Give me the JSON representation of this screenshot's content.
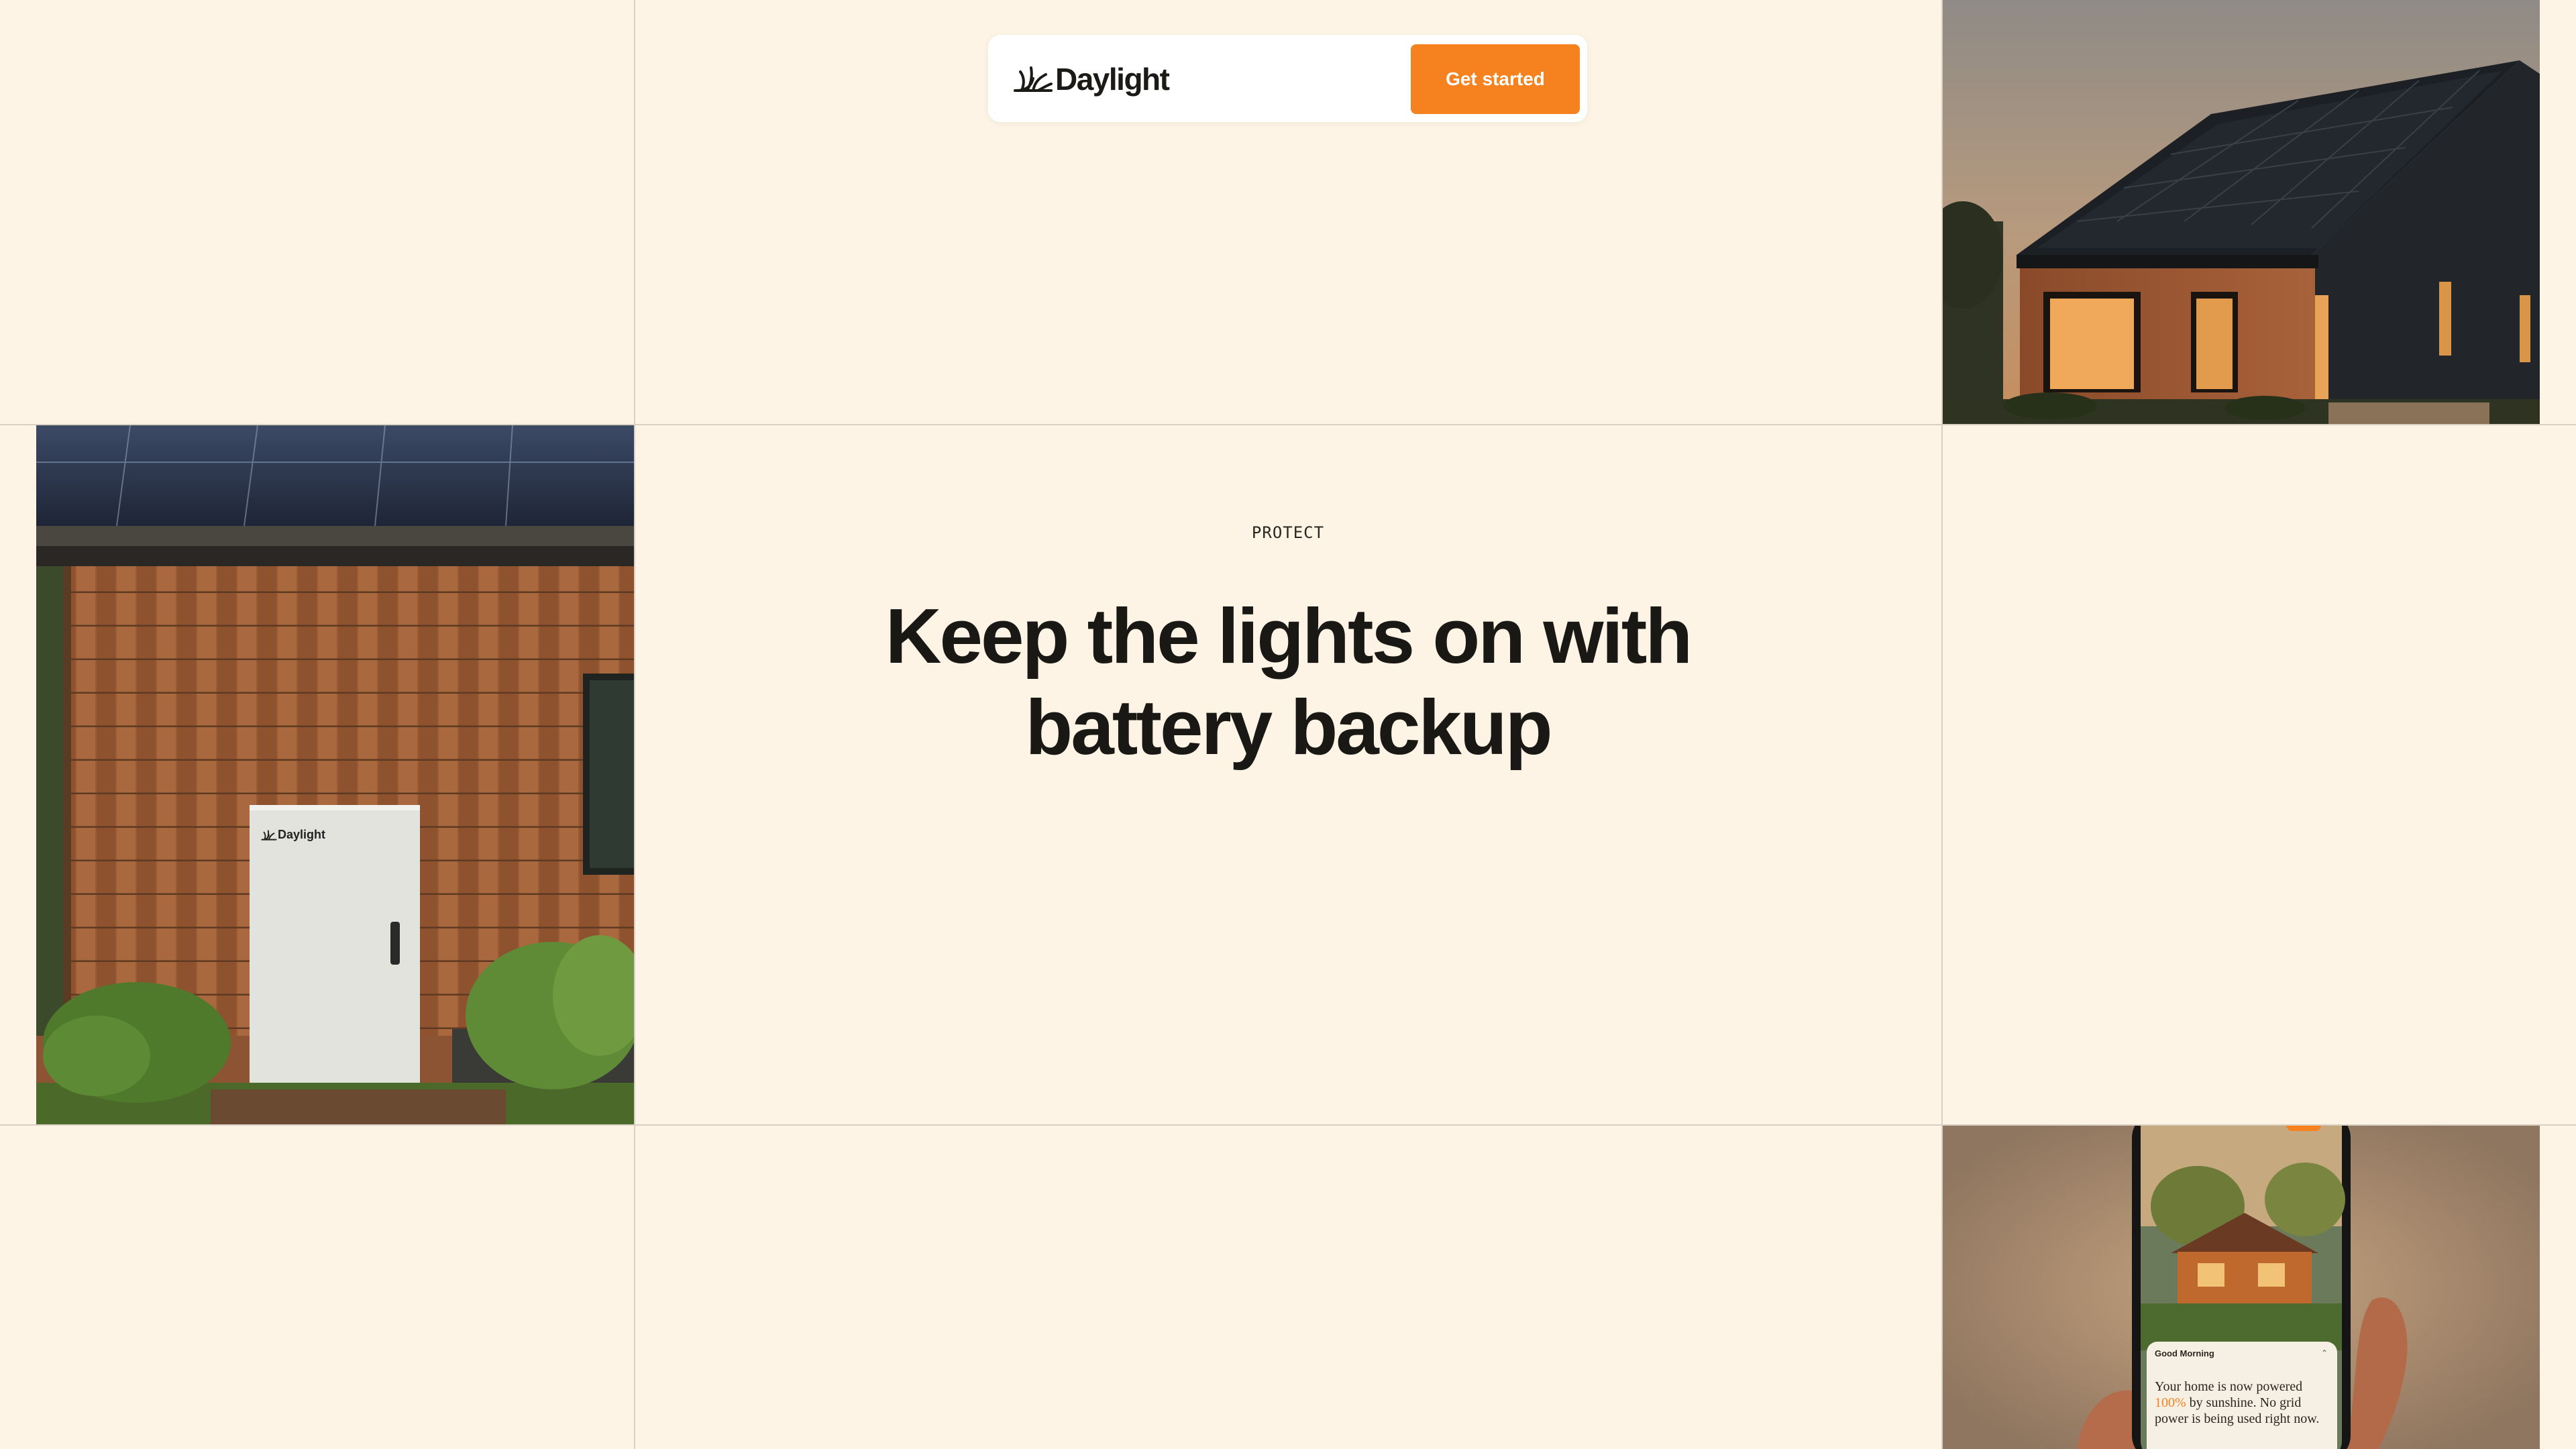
{
  "header": {
    "brand_name": "Daylight",
    "cta_label": "Get started"
  },
  "hero": {
    "eyebrow": "PROTECT",
    "headline_line1": "Keep the lights on with",
    "headline_line2": "battery backup"
  },
  "battery_unit": {
    "brand_name": "Daylight"
  },
  "phone_card": {
    "greeting": "Good Morning",
    "message_line1": "Your home is now powered",
    "message_percent": "100%",
    "message_line2_rest": " by sunshine. No grid",
    "message_line3": "power is being used right now."
  },
  "colors": {
    "background": "#fdf4e6",
    "accent": "#f5821f",
    "grid_line": "#d9cfc2",
    "text": "#1a1814"
  },
  "icons": {
    "brand_mark": "sunburst-logo-icon"
  }
}
